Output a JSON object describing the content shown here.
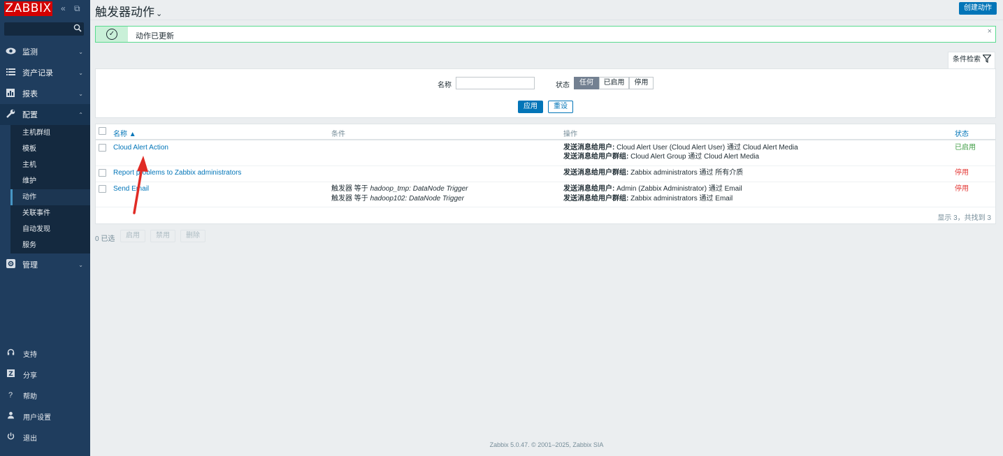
{
  "sidebar": {
    "logo": "ZABBIX",
    "collapse_icon": "«",
    "kiosk_icon": "⧉",
    "search_placeholder": "",
    "menu": [
      {
        "label": "监测",
        "icon": "eye-icon"
      },
      {
        "label": "资产记录",
        "icon": "list-icon"
      },
      {
        "label": "报表",
        "icon": "chart-icon"
      },
      {
        "label": "配置",
        "icon": "wrench-icon"
      },
      {
        "label": "管理",
        "icon": "gear-icon"
      }
    ],
    "config_submenu": [
      "主机群组",
      "模板",
      "主机",
      "维护",
      "动作",
      "关联事件",
      "自动发现",
      "服务"
    ],
    "bottom": [
      {
        "label": "支持",
        "icon": "headset-icon"
      },
      {
        "label": "分享",
        "icon": "share-icon"
      },
      {
        "label": "帮助",
        "icon": "help-icon"
      },
      {
        "label": "用户设置",
        "icon": "user-icon"
      },
      {
        "label": "退出",
        "icon": "power-icon"
      }
    ]
  },
  "header": {
    "title": "触发器动作",
    "create_button": "创建动作"
  },
  "message": {
    "text": "动作已更新"
  },
  "filter": {
    "tab_label": "条件检索",
    "name_label": "名称",
    "name_value": "",
    "status_label": "状态",
    "status_options": [
      "任何",
      "已启用",
      "停用"
    ],
    "status_selected": "任何",
    "apply_button": "应用",
    "reset_button": "重设"
  },
  "table": {
    "columns": [
      "名称 ▲",
      "条件",
      "操作",
      "状态"
    ],
    "rows": [
      {
        "name": "Cloud Alert Action",
        "conditions": [],
        "operations": [
          {
            "bold": "发送消息给用户:",
            "rest": " Cloud Alert User (Cloud Alert User) 通过 Cloud Alert Media"
          },
          {
            "bold": "发送消息给用户群组:",
            "rest": " Cloud Alert Group 通过 Cloud Alert Media"
          }
        ],
        "status": "已启用"
      },
      {
        "name": "Report problems to Zabbix administrators",
        "conditions": [],
        "operations": [
          {
            "bold": "发送消息给用户群组:",
            "rest": " Zabbix administrators 通过 所有介质"
          }
        ],
        "status": "停用"
      },
      {
        "name": "Send Email",
        "conditions": [
          {
            "prefix": "触发器 等于 ",
            "value": "hadoop_tmp: DataNode Trigger"
          },
          {
            "prefix": "触发器 等于 ",
            "value": "hadoop102: DataNode Trigger"
          }
        ],
        "operations": [
          {
            "bold": "发送消息给用户:",
            "rest": " Admin (Zabbix Administrator) 通过 Email"
          },
          {
            "bold": "发送消息给用户群组:",
            "rest": " Zabbix administrators 通过 Email"
          }
        ],
        "status": "停用"
      }
    ],
    "summary": "显示 3，共找到 3"
  },
  "bulk": {
    "selected": "0 已选",
    "buttons": [
      "启用",
      "禁用",
      "删除"
    ]
  },
  "footer": "Zabbix 5.0.47. © 2001–2025, Zabbix SIA",
  "colors": {
    "sidebar_bg": "#1f3d5e",
    "accent": "#0275b8",
    "enabled": "#429e47",
    "disabled": "#e33734",
    "annotation_arrow": "#e02b25"
  }
}
